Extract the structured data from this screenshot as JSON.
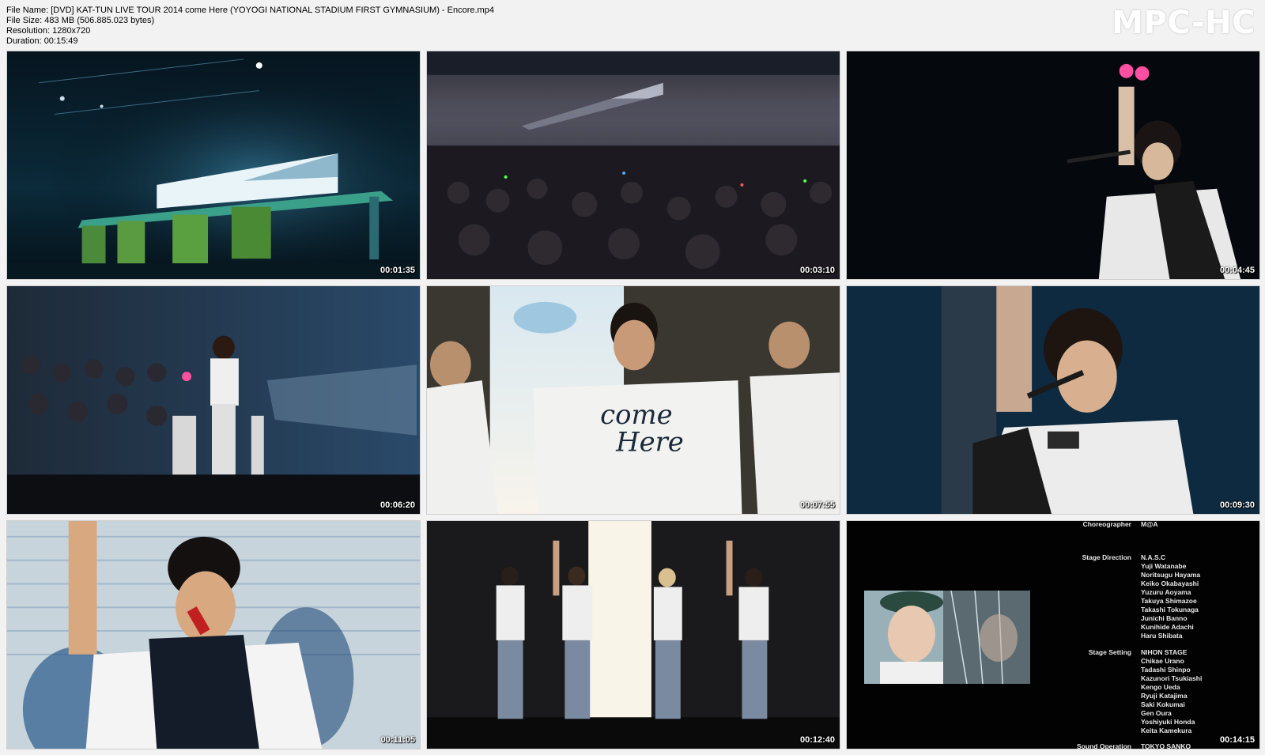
{
  "info": {
    "file_name": "File Name: [DVD] KAT-TUN LIVE TOUR 2014 come Here (YOYOGI NATIONAL STADIUM FIRST GYMNASIUM) - Encore.mp4",
    "file_size": "File Size: 483 MB (506.885.023 bytes)",
    "resolution": "Resolution: 1280x720",
    "duration": "Duration: 00:15:49"
  },
  "logo": "MPC-HC",
  "thumbnails": [
    {
      "timestamp": "00:01:35"
    },
    {
      "timestamp": "00:03:10"
    },
    {
      "timestamp": "00:04:45"
    },
    {
      "timestamp": "00:06:20"
    },
    {
      "timestamp": "00:07:55"
    },
    {
      "timestamp": "00:09:30"
    },
    {
      "timestamp": "00:11:05"
    },
    {
      "timestamp": "00:12:40"
    },
    {
      "timestamp": "00:14:15"
    }
  ],
  "shirt_text": {
    "come": "come",
    "here": "Here"
  },
  "credits": {
    "choreographer_label": "Choreographer",
    "choreographer_value": "M@A",
    "stage_direction_label": "Stage Direction",
    "stage_direction_names": [
      "N.A.S.C",
      "Yuji Watanabe",
      "Noritsugu Hayama",
      "Keiko Okabayashi",
      "Yuzuru Aoyama",
      "Takuya Shimazoe",
      "Takashi Tokunaga",
      "Junichi Banno",
      "Kunihide Adachi",
      "Haru Shibata"
    ],
    "stage_setting_label": "Stage Setting",
    "stage_setting_names": [
      "NIHON STAGE",
      "Chikae Urano",
      "Tadashi Shinpo",
      "Kazunori Tsukiashi",
      "Kengo Ueda",
      "Ryuji Katajima",
      "Saki Kokumai",
      "Gen Oura",
      "Yoshiyuki Honda",
      "Keita Kamekura"
    ],
    "sound_operation_label": "Sound Operation",
    "sound_operation_value": "TOKYO SANKO"
  },
  "colors": {
    "background": "#f2f2f2",
    "logo": "#ffffff",
    "timestamp": "#ffffff"
  }
}
